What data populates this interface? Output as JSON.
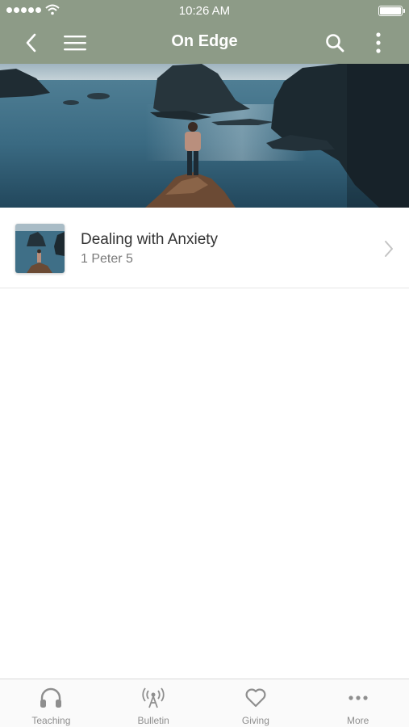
{
  "status_bar": {
    "time": "10:26 AM"
  },
  "nav": {
    "title": "On Edge",
    "back_icon": "chevron-left-icon",
    "menu_icon": "hamburger-menu-icon",
    "search_icon": "search-icon",
    "more_icon": "vertical-ellipsis-icon"
  },
  "theme": {
    "nav_color": "#8d9b87",
    "tab_inactive": "#8e8e8e"
  },
  "list": {
    "items": [
      {
        "title": "Dealing with Anxiety",
        "subtitle": "1 Peter 5"
      }
    ]
  },
  "tab_bar": {
    "tabs": [
      {
        "label": "Teaching",
        "icon": "headphones-icon"
      },
      {
        "label": "Bulletin",
        "icon": "broadcast-icon"
      },
      {
        "label": "Giving",
        "icon": "heart-icon"
      },
      {
        "label": "More",
        "icon": "more-dots-icon"
      }
    ]
  }
}
